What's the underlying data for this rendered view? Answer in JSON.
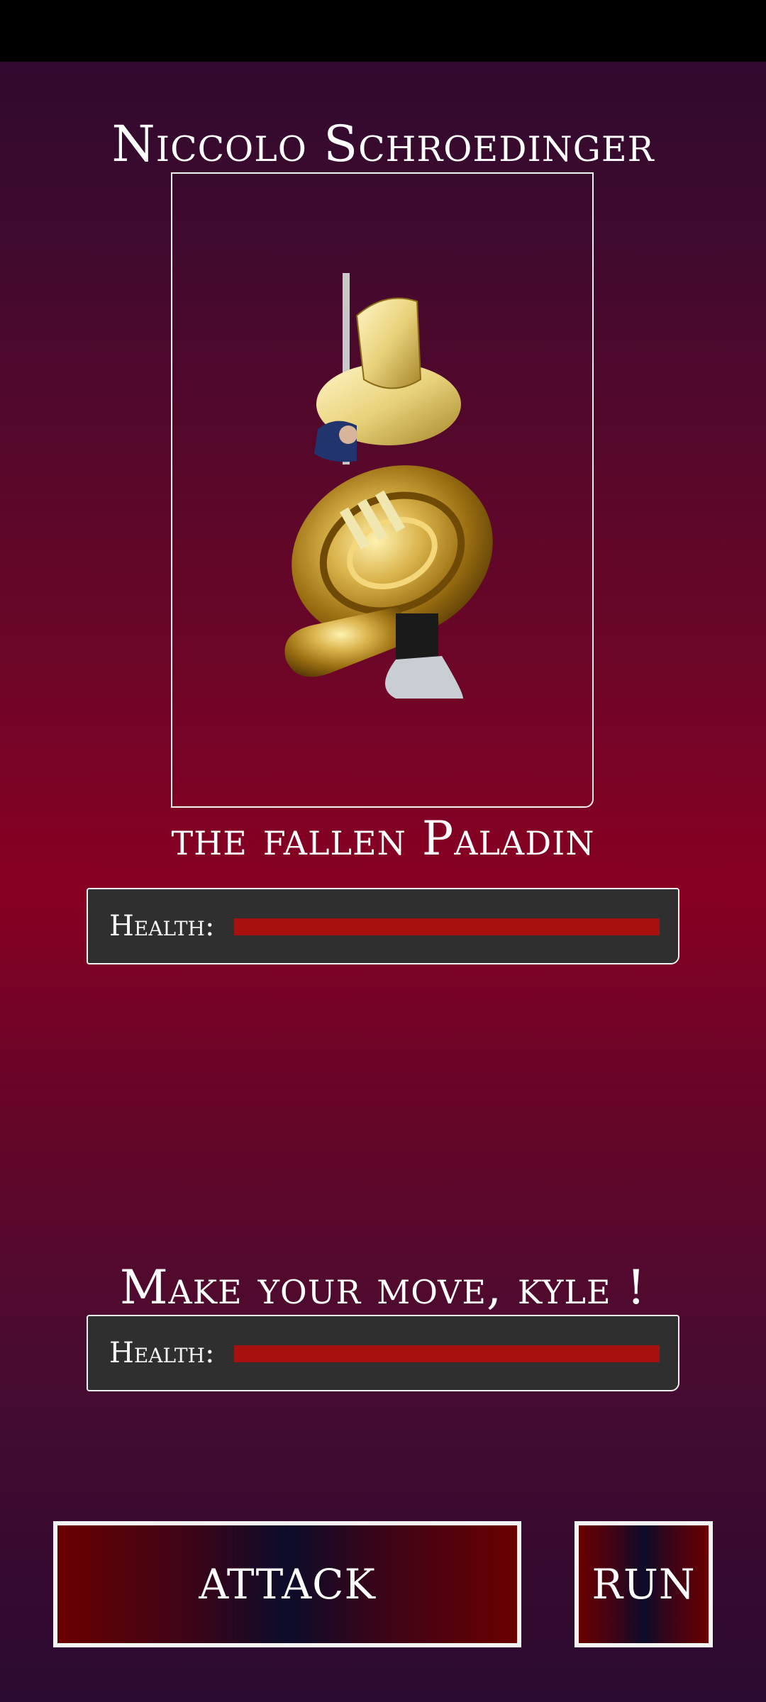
{
  "enemy": {
    "name": "Niccolo Schroedinger",
    "subtitle": "the fallen Paladin",
    "portrait_icon": "tuba-paladin-portrait",
    "health_label": "Health:",
    "health_fraction": 1.0
  },
  "player": {
    "prompt": "Make your move, kyle !",
    "health_label": "Health:",
    "health_fraction": 1.0
  },
  "actions": {
    "attack_label": "ATTACK",
    "run_label": "RUN"
  },
  "colors": {
    "health_bar": "#a81010",
    "panel_bg": "#2f2f2f",
    "border": "#f0f0f0"
  }
}
